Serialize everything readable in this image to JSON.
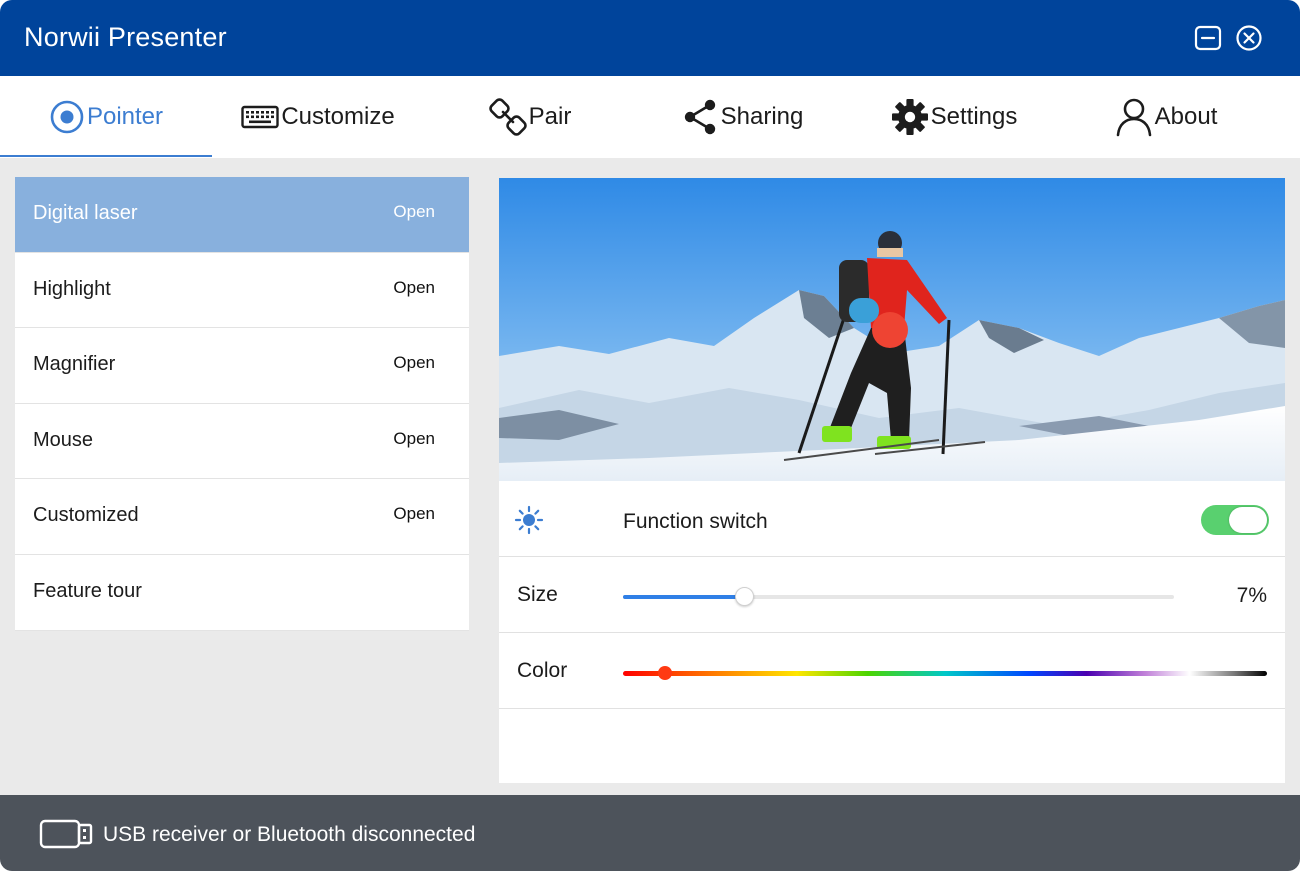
{
  "window": {
    "title": "Norwii Presenter"
  },
  "titlebar_buttons": [
    {
      "name": "minimize",
      "icon": "minimize-icon"
    },
    {
      "name": "close",
      "icon": "close-circle-icon"
    }
  ],
  "tabs": [
    {
      "label": "Pointer",
      "icon": "pointer-target-icon",
      "active": true
    },
    {
      "label": "Customize",
      "icon": "keyboard-icon",
      "active": false
    },
    {
      "label": "Pair",
      "icon": "link-icon",
      "active": false
    },
    {
      "label": "Sharing",
      "icon": "share-icon",
      "active": false
    },
    {
      "label": "Settings",
      "icon": "gear-icon",
      "active": false
    },
    {
      "label": "About",
      "icon": "user-icon",
      "active": false
    }
  ],
  "features": [
    {
      "name": "Digital laser",
      "action": "Open",
      "selected": true
    },
    {
      "name": "Highlight",
      "action": "Open",
      "selected": false
    },
    {
      "name": "Magnifier",
      "action": "Open",
      "selected": false
    },
    {
      "name": "Mouse",
      "action": "Open",
      "selected": false
    },
    {
      "name": "Customized",
      "action": "Open",
      "selected": false
    },
    {
      "name": "Feature tour",
      "action": "",
      "selected": false
    }
  ],
  "detail": {
    "preview": {
      "image": "skier-mountain-preview",
      "laser_dot_color": "#ee4433"
    },
    "function_switch": {
      "icon": "sun-icon",
      "label": "Function switch",
      "on": true
    },
    "size": {
      "label": "Size",
      "value_text": "7%",
      "fraction": 0.22
    },
    "color": {
      "label": "Color",
      "fraction": 0.065,
      "selected_color": "#ff3a12"
    }
  },
  "status": {
    "icon": "usb-receiver-icon",
    "text": "USB receiver or Bluetooth disconnected"
  },
  "colors": {
    "titlebar": "#00449b",
    "accent": "#3c7dd1",
    "selection": "#88b0dd",
    "toggle_on": "#59d06f",
    "slider_fill": "#2f7fe6",
    "statusbar": "#4d535b"
  }
}
